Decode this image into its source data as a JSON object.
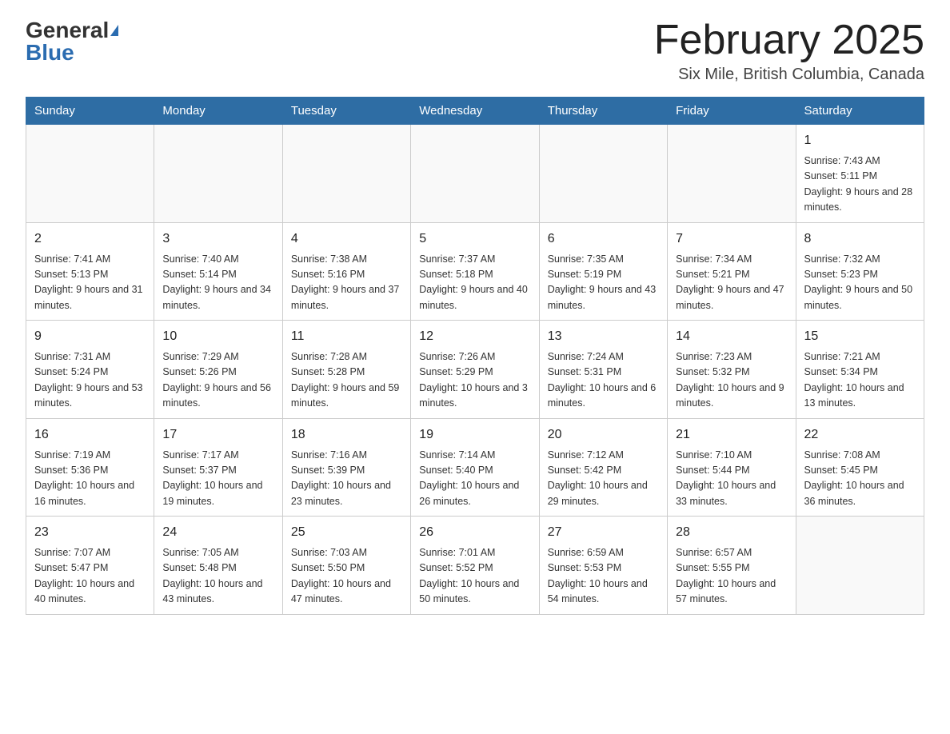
{
  "header": {
    "logo_general": "General",
    "logo_blue": "Blue",
    "title": "February 2025",
    "location": "Six Mile, British Columbia, Canada"
  },
  "days_of_week": [
    "Sunday",
    "Monday",
    "Tuesday",
    "Wednesday",
    "Thursday",
    "Friday",
    "Saturday"
  ],
  "weeks": [
    [
      {
        "day": "",
        "info": ""
      },
      {
        "day": "",
        "info": ""
      },
      {
        "day": "",
        "info": ""
      },
      {
        "day": "",
        "info": ""
      },
      {
        "day": "",
        "info": ""
      },
      {
        "day": "",
        "info": ""
      },
      {
        "day": "1",
        "info": "Sunrise: 7:43 AM\nSunset: 5:11 PM\nDaylight: 9 hours and 28 minutes."
      }
    ],
    [
      {
        "day": "2",
        "info": "Sunrise: 7:41 AM\nSunset: 5:13 PM\nDaylight: 9 hours and 31 minutes."
      },
      {
        "day": "3",
        "info": "Sunrise: 7:40 AM\nSunset: 5:14 PM\nDaylight: 9 hours and 34 minutes."
      },
      {
        "day": "4",
        "info": "Sunrise: 7:38 AM\nSunset: 5:16 PM\nDaylight: 9 hours and 37 minutes."
      },
      {
        "day": "5",
        "info": "Sunrise: 7:37 AM\nSunset: 5:18 PM\nDaylight: 9 hours and 40 minutes."
      },
      {
        "day": "6",
        "info": "Sunrise: 7:35 AM\nSunset: 5:19 PM\nDaylight: 9 hours and 43 minutes."
      },
      {
        "day": "7",
        "info": "Sunrise: 7:34 AM\nSunset: 5:21 PM\nDaylight: 9 hours and 47 minutes."
      },
      {
        "day": "8",
        "info": "Sunrise: 7:32 AM\nSunset: 5:23 PM\nDaylight: 9 hours and 50 minutes."
      }
    ],
    [
      {
        "day": "9",
        "info": "Sunrise: 7:31 AM\nSunset: 5:24 PM\nDaylight: 9 hours and 53 minutes."
      },
      {
        "day": "10",
        "info": "Sunrise: 7:29 AM\nSunset: 5:26 PM\nDaylight: 9 hours and 56 minutes."
      },
      {
        "day": "11",
        "info": "Sunrise: 7:28 AM\nSunset: 5:28 PM\nDaylight: 9 hours and 59 minutes."
      },
      {
        "day": "12",
        "info": "Sunrise: 7:26 AM\nSunset: 5:29 PM\nDaylight: 10 hours and 3 minutes."
      },
      {
        "day": "13",
        "info": "Sunrise: 7:24 AM\nSunset: 5:31 PM\nDaylight: 10 hours and 6 minutes."
      },
      {
        "day": "14",
        "info": "Sunrise: 7:23 AM\nSunset: 5:32 PM\nDaylight: 10 hours and 9 minutes."
      },
      {
        "day": "15",
        "info": "Sunrise: 7:21 AM\nSunset: 5:34 PM\nDaylight: 10 hours and 13 minutes."
      }
    ],
    [
      {
        "day": "16",
        "info": "Sunrise: 7:19 AM\nSunset: 5:36 PM\nDaylight: 10 hours and 16 minutes."
      },
      {
        "day": "17",
        "info": "Sunrise: 7:17 AM\nSunset: 5:37 PM\nDaylight: 10 hours and 19 minutes."
      },
      {
        "day": "18",
        "info": "Sunrise: 7:16 AM\nSunset: 5:39 PM\nDaylight: 10 hours and 23 minutes."
      },
      {
        "day": "19",
        "info": "Sunrise: 7:14 AM\nSunset: 5:40 PM\nDaylight: 10 hours and 26 minutes."
      },
      {
        "day": "20",
        "info": "Sunrise: 7:12 AM\nSunset: 5:42 PM\nDaylight: 10 hours and 29 minutes."
      },
      {
        "day": "21",
        "info": "Sunrise: 7:10 AM\nSunset: 5:44 PM\nDaylight: 10 hours and 33 minutes."
      },
      {
        "day": "22",
        "info": "Sunrise: 7:08 AM\nSunset: 5:45 PM\nDaylight: 10 hours and 36 minutes."
      }
    ],
    [
      {
        "day": "23",
        "info": "Sunrise: 7:07 AM\nSunset: 5:47 PM\nDaylight: 10 hours and 40 minutes."
      },
      {
        "day": "24",
        "info": "Sunrise: 7:05 AM\nSunset: 5:48 PM\nDaylight: 10 hours and 43 minutes."
      },
      {
        "day": "25",
        "info": "Sunrise: 7:03 AM\nSunset: 5:50 PM\nDaylight: 10 hours and 47 minutes."
      },
      {
        "day": "26",
        "info": "Sunrise: 7:01 AM\nSunset: 5:52 PM\nDaylight: 10 hours and 50 minutes."
      },
      {
        "day": "27",
        "info": "Sunrise: 6:59 AM\nSunset: 5:53 PM\nDaylight: 10 hours and 54 minutes."
      },
      {
        "day": "28",
        "info": "Sunrise: 6:57 AM\nSunset: 5:55 PM\nDaylight: 10 hours and 57 minutes."
      },
      {
        "day": "",
        "info": ""
      }
    ]
  ]
}
